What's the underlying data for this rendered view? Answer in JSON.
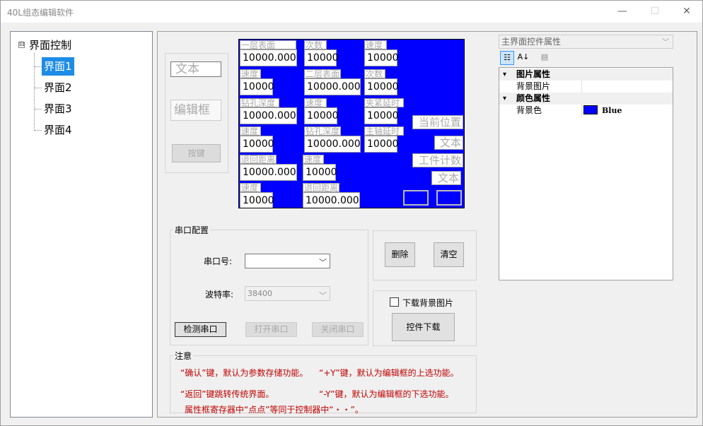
{
  "window": {
    "title": "40L组态编辑软件",
    "min_glyph": "—",
    "max_glyph": "☐",
    "close_glyph": "✕"
  },
  "tree": {
    "expander": "⊟",
    "root": "界面控制",
    "items": [
      {
        "label": "界面1",
        "selected": true
      },
      {
        "label": "界面2",
        "selected": false
      },
      {
        "label": "界面3",
        "selected": false
      },
      {
        "label": "界面4",
        "selected": false
      }
    ]
  },
  "palette": {
    "label": "文本",
    "edit": "编辑框",
    "button": "按键"
  },
  "canvas": {
    "background": "#0000ff",
    "labels": [
      "一层表面",
      "次数",
      "速度",
      "速度",
      "二层表面",
      "次数",
      "钻孔深度",
      "速度",
      "夹紧延时",
      "速度",
      "钻孔深度",
      "主轴延时",
      "退回距离",
      "速度",
      "速度",
      "退回距离"
    ],
    "values": [
      "10000.000",
      "10000",
      "10000",
      "10000",
      "10000.000",
      "10000",
      "10000.000",
      "10000",
      "10000",
      "10000",
      "10000.000",
      "10000",
      "10000.000",
      "10000",
      "10000",
      "10000.000"
    ],
    "bigs": [
      "当前位置",
      "文本",
      "工件计数",
      "文本"
    ]
  },
  "serial": {
    "group_title": "串口配置",
    "port_label": "串口号:",
    "port_value": "",
    "baud_label": "波特率:",
    "baud_value": "38400",
    "detect_button": "检测串口",
    "open_button": "打开串口",
    "close_button": "关闭串口"
  },
  "actions": {
    "delete_button": "删除",
    "clear_button": "清空"
  },
  "download": {
    "checkbox_label": "下载背景图片",
    "checked": false,
    "download_button": "控件下载"
  },
  "notes": {
    "title": "注意",
    "lines": [
      "“确认”键，默认为参数存储功能。",
      "“+Y”键，默认为编辑框的上选功能。",
      "“返回”键跳转传统界面。",
      "“-Y”键，默认为编辑框的下选功能。",
      "属性框寄存器中“点点”等同于控制器中“・・”。"
    ]
  },
  "properties": {
    "selector": "主界面控件属性",
    "toolbar": {
      "categorized": "☷",
      "alphabetical": "A↓",
      "pages": "▤"
    },
    "categories": [
      {
        "name": "图片属性",
        "rows": [
          {
            "name": "背景图片",
            "value": ""
          }
        ]
      },
      {
        "name": "颜色属性",
        "rows": [
          {
            "name": "背景色",
            "value": "Blue",
            "color": "#0000ff"
          }
        ]
      }
    ]
  }
}
